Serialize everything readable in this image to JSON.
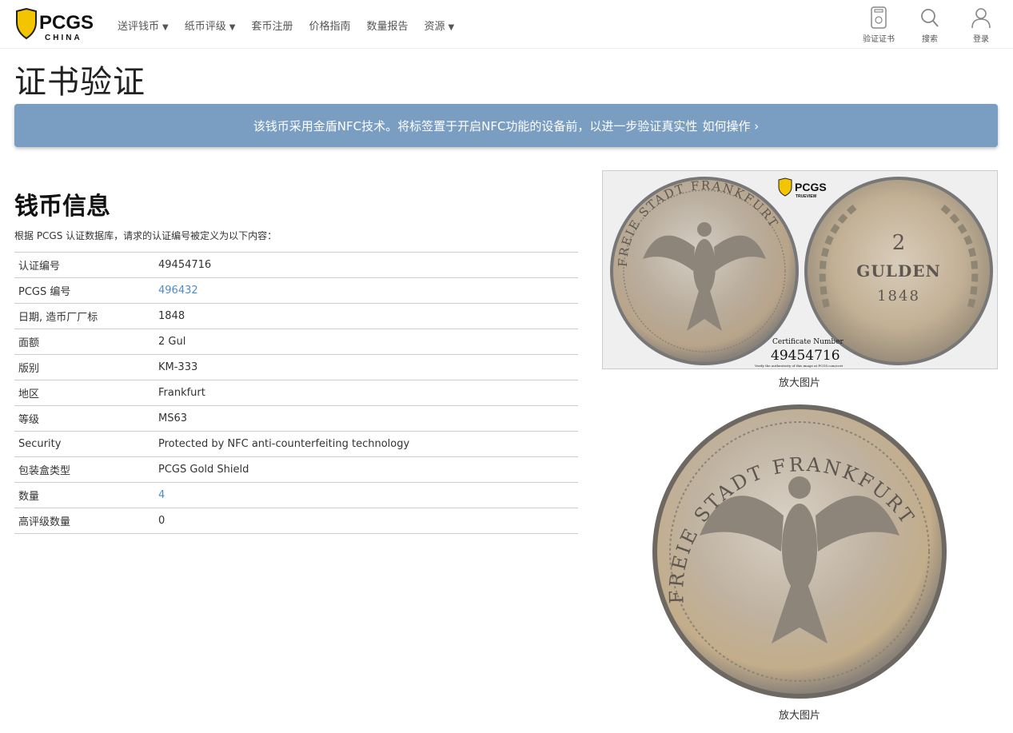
{
  "header": {
    "logo": {
      "brand": "PCGS",
      "sub": "CHINA"
    },
    "nav": [
      {
        "label": "送评钱币",
        "dropdown": true
      },
      {
        "label": "纸币评级",
        "dropdown": true
      },
      {
        "label": "套币注册",
        "dropdown": false
      },
      {
        "label": "价格指南",
        "dropdown": false
      },
      {
        "label": "数量报告",
        "dropdown": false
      },
      {
        "label": "资源",
        "dropdown": true
      }
    ],
    "tools": [
      {
        "label": "验证证书",
        "icon": "certificate-icon"
      },
      {
        "label": "搜索",
        "icon": "search-icon"
      },
      {
        "label": "登录",
        "icon": "user-icon"
      }
    ],
    "caret": "▼"
  },
  "page_title": "证书验证",
  "nfc_banner": {
    "text": "该钱币采用金盾NFC技术。将标签置于开启NFC功能的设备前，以进一步验证真实性",
    "link": "如何操作 ›"
  },
  "coin_info": {
    "title": "钱币信息",
    "intro": "根据 PCGS 认证数据库，请求的认证编号被定义为以下内容：",
    "rows": [
      {
        "label": "认证编号",
        "value": "49454716",
        "link": false
      },
      {
        "label": "PCGS 编号",
        "value": "496432",
        "link": true
      },
      {
        "label": "日期, 造币厂厂标",
        "value": "1848",
        "link": false
      },
      {
        "label": "面额",
        "value": "2 Gul",
        "link": false
      },
      {
        "label": "版别",
        "value": "KM-333",
        "link": false
      },
      {
        "label": "地区",
        "value": "Frankfurt",
        "link": false
      },
      {
        "label": "等级",
        "value": "MS63",
        "link": false
      },
      {
        "label": "Security",
        "value": "Protected by NFC anti-counterfeiting technology",
        "link": false
      },
      {
        "label": "包装盒类型",
        "value": "PCGS Gold Shield",
        "link": false
      },
      {
        "label": "数量",
        "value": "4",
        "link": true
      },
      {
        "label": "高评级数量",
        "value": "0",
        "link": false
      }
    ]
  },
  "images": {
    "trueview": {
      "legend": "FREIE STADT FRANKFURT",
      "denomination": "2",
      "unit": "GULDEN",
      "year": "1848",
      "badge": "PCGS",
      "badge_sub": "TRUEVIEW",
      "cert_label": "Certificate Number",
      "cert_number": "49454716",
      "verify_note": "Verify the authenticity of this image at PCGS.com/cert",
      "caption": "放大图片"
    },
    "obverse": {
      "legend": "FREIE STADT FRANKFURT",
      "caption": "放大图片"
    }
  },
  "colors": {
    "banner": "#7a9ec2",
    "link": "#4a8dc8",
    "logo_gold": "#f2c500"
  }
}
